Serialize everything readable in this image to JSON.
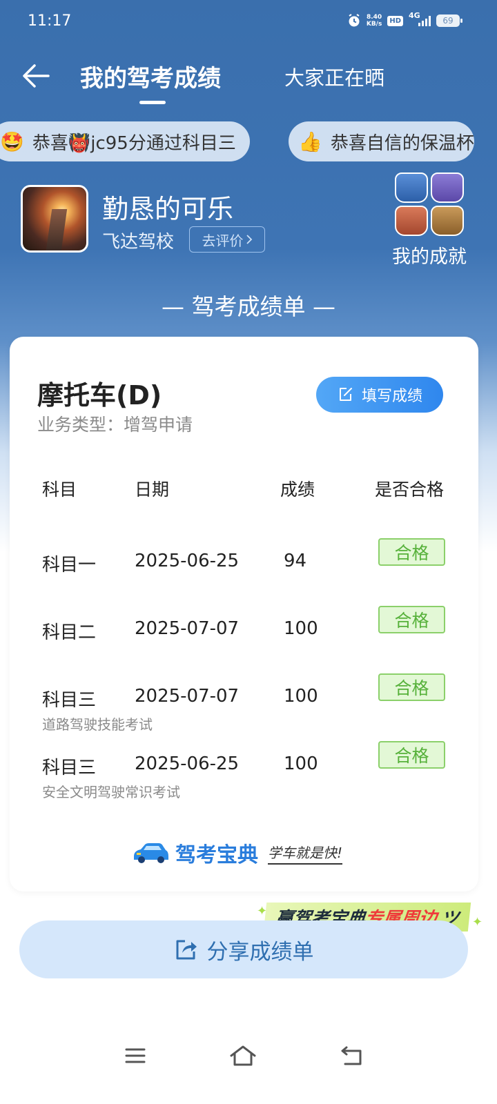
{
  "status_bar": {
    "time": "11:17",
    "net_speed_value": "8.40",
    "net_speed_unit": "KB/s",
    "hd_label": "HD",
    "network_type": "4G",
    "battery_level": "69"
  },
  "nav": {
    "active_tab": "我的驾考成绩",
    "other_tab": "大家正在晒"
  },
  "ticker": [
    {
      "emoji": "🤩",
      "text": "恭喜👹jc95分通过科目三"
    },
    {
      "emoji": "👍",
      "text": "恭喜自信的保温杯"
    }
  ],
  "profile": {
    "user_name": "勤恳的可乐",
    "school": "飞达驾校",
    "review_button": "去评价",
    "achievements_label": "我的成就"
  },
  "sheet_title": "— 驾考成绩单 —",
  "card": {
    "vehicle_type": "摩托车(D)",
    "business_type": "业务类型：增驾申请",
    "fill_button": "填写成绩",
    "columns": [
      "科目",
      "日期",
      "成绩",
      "是否合格"
    ],
    "rows": [
      {
        "subject": "科目一",
        "date": "2025-06-25",
        "score": "94",
        "result": "合格",
        "note": ""
      },
      {
        "subject": "科目二",
        "date": "2025-07-07",
        "score": "100",
        "result": "合格",
        "note": ""
      },
      {
        "subject": "科目三",
        "date": "2025-07-07",
        "score": "100",
        "result": "合格",
        "note": "道路驾驶技能考试"
      },
      {
        "subject": "科目三",
        "date": "2025-06-25",
        "score": "100",
        "result": "合格",
        "note": "安全文明驾驶常识考试"
      }
    ],
    "brand_name": "驾考宝典",
    "brand_slogan": "学车就是快!"
  },
  "promo": {
    "part1": "赢驾考宝典",
    "part2": "专属周边"
  },
  "share_button": "分享成绩单",
  "colors": {
    "primary_blue": "#3a6fad",
    "button_blue": "#2f87ee",
    "pass_green": "#56b13a"
  }
}
